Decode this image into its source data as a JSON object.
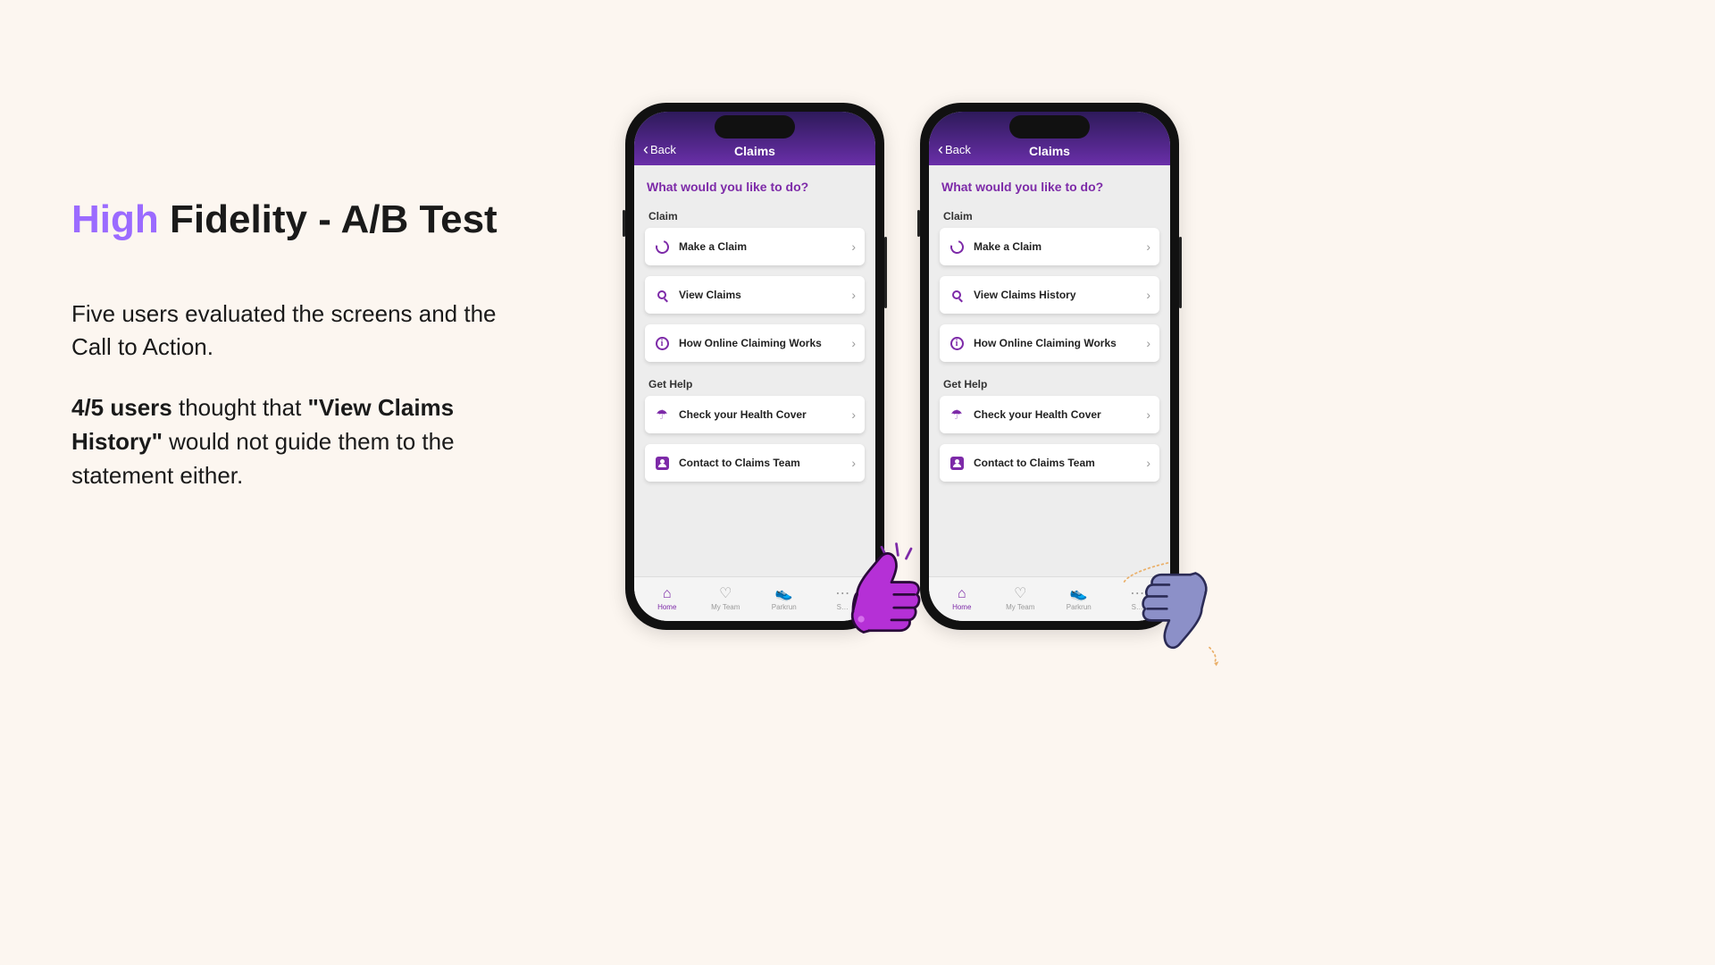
{
  "title_accent": "High",
  "title_rest": " Fidelity - A/B Test",
  "para1": "Five users evaluated the screens and the Call to Action.",
  "para2_strong1": "4/5 users",
  "para2_mid": " thought that ",
  "para2_strong2": "\"View Claims History\"",
  "para2_end": " would not guide them to the statement either.",
  "phone": {
    "back": "Back",
    "header_title": "Claims",
    "prompt": "What would you like to do?",
    "section_claim": "Claim",
    "section_help": "Get Help",
    "tabs": {
      "home": "Home",
      "team": "My Team",
      "parkrun": "Parkrun",
      "more": "S…"
    }
  },
  "phoneA": {
    "items_claim": [
      {
        "label": "Make a Claim",
        "icon": "refresh"
      },
      {
        "label": "View Claims",
        "icon": "search"
      },
      {
        "label": "How Online Claiming Works",
        "icon": "info"
      }
    ],
    "items_help": [
      {
        "label": "Check your Health Cover",
        "icon": "umbrella"
      },
      {
        "label": "Contact to Claims Team",
        "icon": "person"
      }
    ]
  },
  "phoneB": {
    "items_claim": [
      {
        "label": "Make a Claim",
        "icon": "refresh"
      },
      {
        "label": "View Claims History",
        "icon": "search"
      },
      {
        "label": "How Online Claiming Works",
        "icon": "info"
      }
    ],
    "items_help": [
      {
        "label": "Check your Health Cover",
        "icon": "umbrella"
      },
      {
        "label": "Contact to Claims Team",
        "icon": "person"
      }
    ]
  }
}
